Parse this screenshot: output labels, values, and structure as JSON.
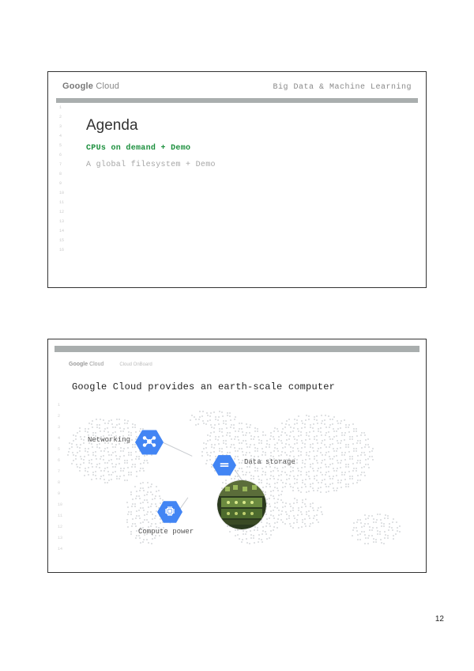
{
  "page_number": "12",
  "slide1": {
    "brand_prefix": "Google",
    "brand_suffix": " Cloud",
    "header_right": "Big Data & Machine Learning",
    "title": "Agenda",
    "items": [
      {
        "text": "CPUs on demand + Demo",
        "highlight": true
      },
      {
        "text": "A global filesystem + Demo",
        "highlight": false
      }
    ],
    "line_numbers": [
      "1",
      "2",
      "3",
      "4",
      "5",
      "6",
      "7",
      "8",
      "9",
      "10",
      "11",
      "12",
      "13",
      "14",
      "15",
      "16"
    ]
  },
  "slide2": {
    "brand_prefix": "Google",
    "brand_suffix": " Cloud",
    "brand_sub": "Cloud OnBoard",
    "title": "Google Cloud provides an earth-scale computer",
    "nodes": {
      "networking": "Networking",
      "storage": "Data storage",
      "compute": "Compute power"
    },
    "line_numbers": [
      "1",
      "2",
      "3",
      "4",
      "5",
      "6",
      "7",
      "8",
      "9",
      "10",
      "11",
      "12",
      "13",
      "14"
    ],
    "accent_color": "#4285F4"
  }
}
